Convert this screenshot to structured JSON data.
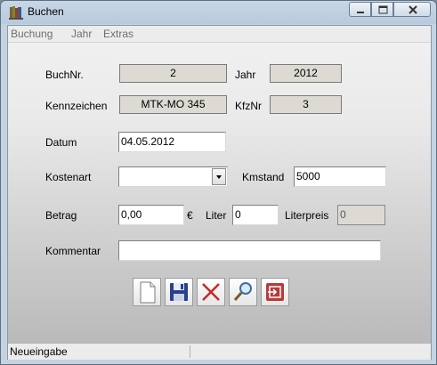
{
  "window": {
    "title": "Buchen"
  },
  "menu": [
    {
      "label": "Buchung"
    },
    {
      "label": "Jahr"
    },
    {
      "label": "Extras"
    }
  ],
  "form": {
    "buchnr": {
      "label": "BuchNr.",
      "value": "2"
    },
    "jahr": {
      "label": "Jahr",
      "value": "2012"
    },
    "kennzeichen": {
      "label": "Kennzeichen",
      "value": "MTK-MO 345"
    },
    "kfznr": {
      "label": "KfzNr",
      "value": "3"
    },
    "datum": {
      "label": "Datum",
      "value": "04.05.2012"
    },
    "kostenart": {
      "label": "Kostenart",
      "value": ""
    },
    "kmstand": {
      "label": "Kmstand",
      "value": "5000"
    },
    "betrag": {
      "label": "Betrag",
      "value": "0,00",
      "currency": "€"
    },
    "liter": {
      "label": "Liter",
      "value": "0"
    },
    "literpreis": {
      "label": "Literpreis",
      "value": "0"
    },
    "kommentar": {
      "label": "Kommentar",
      "value": ""
    }
  },
  "toolbar": [
    {
      "name": "new-document-icon"
    },
    {
      "name": "save-disk-icon"
    },
    {
      "name": "delete-x-icon"
    },
    {
      "name": "search-magnifier-icon"
    },
    {
      "name": "exit-icon"
    }
  ],
  "status": {
    "text": "Neueingabe"
  },
  "colors": {
    "title_bg": "#b8cade",
    "client_top": "#f2f2f2",
    "client_bottom": "#b6b6b6",
    "readonly_bg": "#dcdad3",
    "exit_red": "#b83a3a",
    "delete_red": "#c62828",
    "save_blue": "#2a3f8f"
  }
}
